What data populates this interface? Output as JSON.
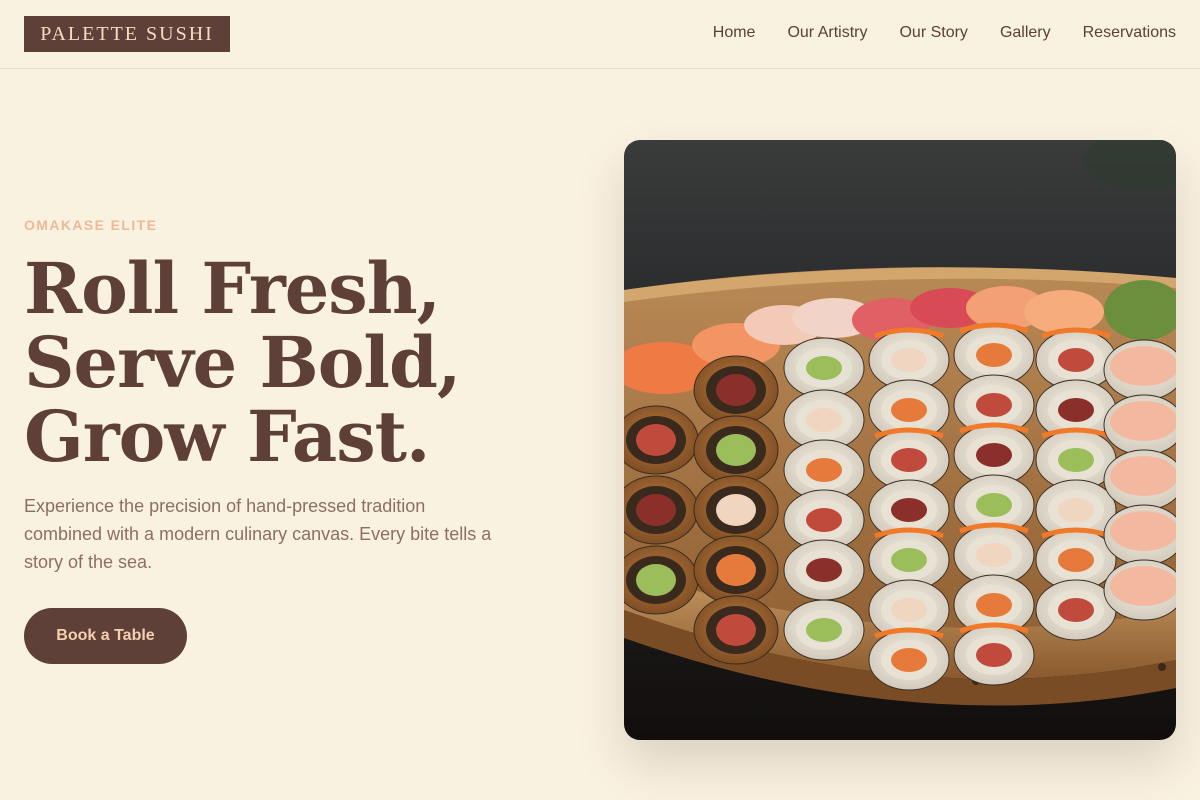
{
  "header": {
    "logo": "PALETTE SUSHI",
    "nav": [
      {
        "label": "Home"
      },
      {
        "label": "Our Artistry"
      },
      {
        "label": "Our Story"
      },
      {
        "label": "Gallery"
      },
      {
        "label": "Reservations"
      }
    ]
  },
  "hero": {
    "eyebrow": "OMAKASE ELITE",
    "headline_lines": [
      "Roll Fresh,",
      "Serve Bold,",
      "Grow Fast."
    ],
    "description": "Experience the precision of hand-pressed tradition combined with a modern culinary canvas. Every bite tells a story of the sea.",
    "cta_label": "Book a Table",
    "image": "sushi-boat-platter-photo"
  },
  "colors": {
    "background": "#faf2e1",
    "brand": "#5e4038",
    "accent": "#f0b898",
    "text_muted": "#8d6f62"
  }
}
